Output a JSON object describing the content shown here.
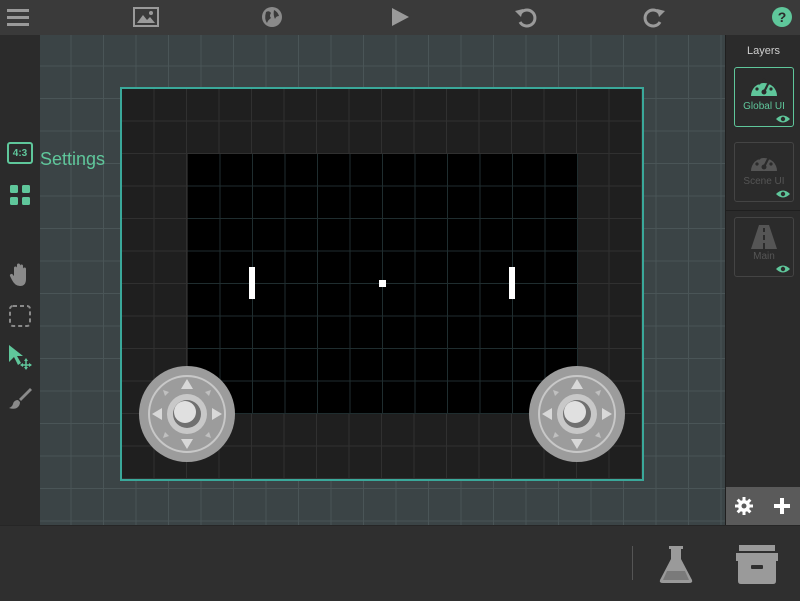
{
  "toolbar": {
    "icons": [
      "menu-icon",
      "image-icon",
      "globe-icon",
      "play-icon",
      "undo-icon",
      "redo-icon",
      "help-icon"
    ]
  },
  "left_toolbar": {
    "aspect_badge": "4:3",
    "settings_label": "Settings",
    "icons": [
      "aspect-ratio-icon",
      "grid-apps-icon",
      "hand-icon",
      "selection-icon",
      "pointer-move-icon",
      "brush-icon"
    ]
  },
  "layers_panel": {
    "title": "Layers",
    "items": [
      {
        "label": "Global UI",
        "icon": "gauge-icon",
        "active": true
      },
      {
        "label": "Scene UI",
        "icon": "gauge-icon",
        "active": false
      },
      {
        "label": "Main",
        "icon": "road-icon",
        "active": false
      }
    ]
  },
  "bottom_bar": {
    "icons": [
      "flask-icon",
      "archive-icon"
    ]
  },
  "colors": {
    "accent": "#5fc79b",
    "scene_border": "#3aa89a",
    "toolbar_bg": "#3a3a3a"
  }
}
